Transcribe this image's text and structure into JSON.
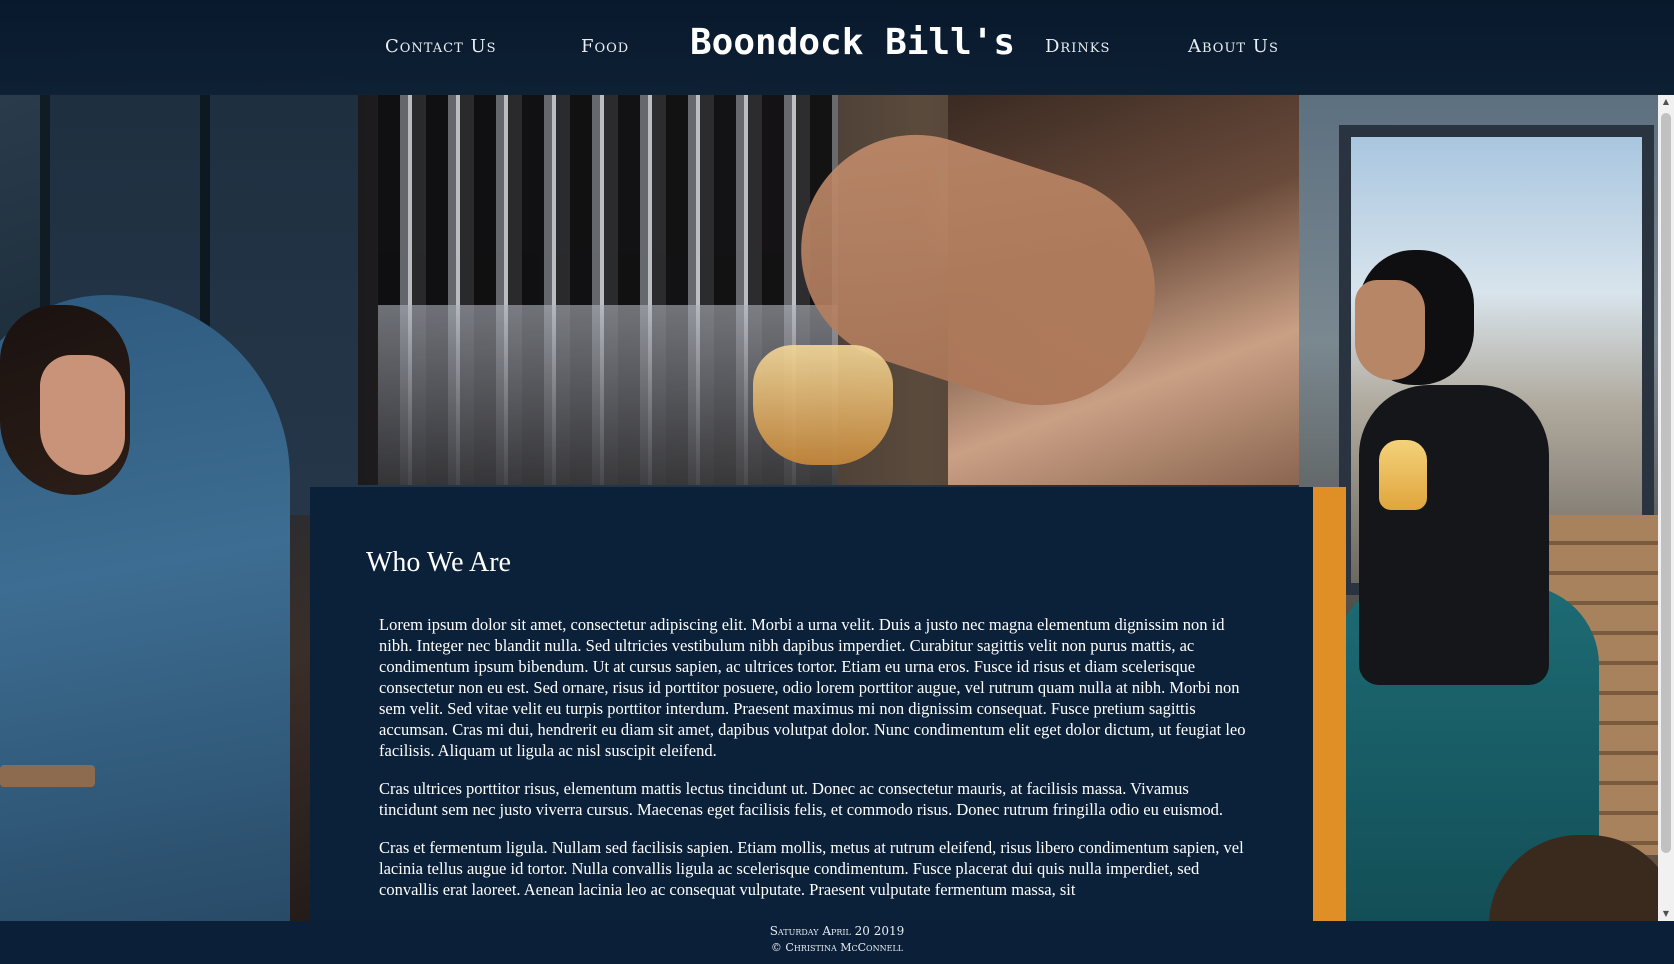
{
  "header": {
    "brand": "Boondock Bill's",
    "nav": {
      "contact": "Contact Us",
      "food": "Food",
      "drinks": "Drinks",
      "about": "About Us"
    }
  },
  "main": {
    "title": "Who We Are",
    "paragraphs": [
      "Lorem ipsum dolor sit amet, consectetur adipiscing elit. Morbi a urna velit. Duis a justo nec magna elementum dignissim non id nibh. Integer nec blandit nulla. Sed ultricies vestibulum nibh dapibus imperdiet. Curabitur sagittis velit non purus mattis, ac condimentum ipsum bibendum. Ut at cursus sapien, ac ultrices tortor. Etiam eu urna eros. Fusce id risus et diam scelerisque consectetur non eu est. Sed ornare, risus id porttitor posuere, odio lorem porttitor augue, vel rutrum quam nulla at nibh. Morbi non sem velit. Sed vitae velit eu turpis porttitor interdum. Praesent maximus mi non dignissim consequat. Fusce pretium sagittis accumsan. Cras mi dui, hendrerit eu diam sit amet, dapibus volutpat dolor. Nunc condimentum elit eget dolor dictum, ut feugiat leo facilisis. Aliquam ut ligula ac nisl suscipit eleifend.",
      "Cras ultrices porttitor risus, elementum mattis lectus tincidunt ut. Donec ac consectetur mauris, at facilisis massa. Vivamus tincidunt sem nec justo viverra cursus. Maecenas eget facilisis felis, et commodo risus. Donec rutrum fringilla odio eu euismod.",
      "Cras et fermentum ligula. Nullam sed facilisis sapien. Etiam mollis, metus at rutrum eleifend, risus libero condimentum sapien, vel lacinia tellus augue id tortor. Nulla convallis ligula ac scelerisque condimentum. Fusce placerat dui quis nulla imperdiet, sed convallis erat laoreet. Aenean lacinia leo ac consequat vulputate. Praesent vulputate fermentum massa, sit"
    ]
  },
  "footer": {
    "date": "Saturday April 20 2019",
    "copyright": "© Christina McConnell"
  },
  "colors": {
    "navy": "#0b2039",
    "accent": "#e08f27",
    "text": "#ffffff"
  }
}
